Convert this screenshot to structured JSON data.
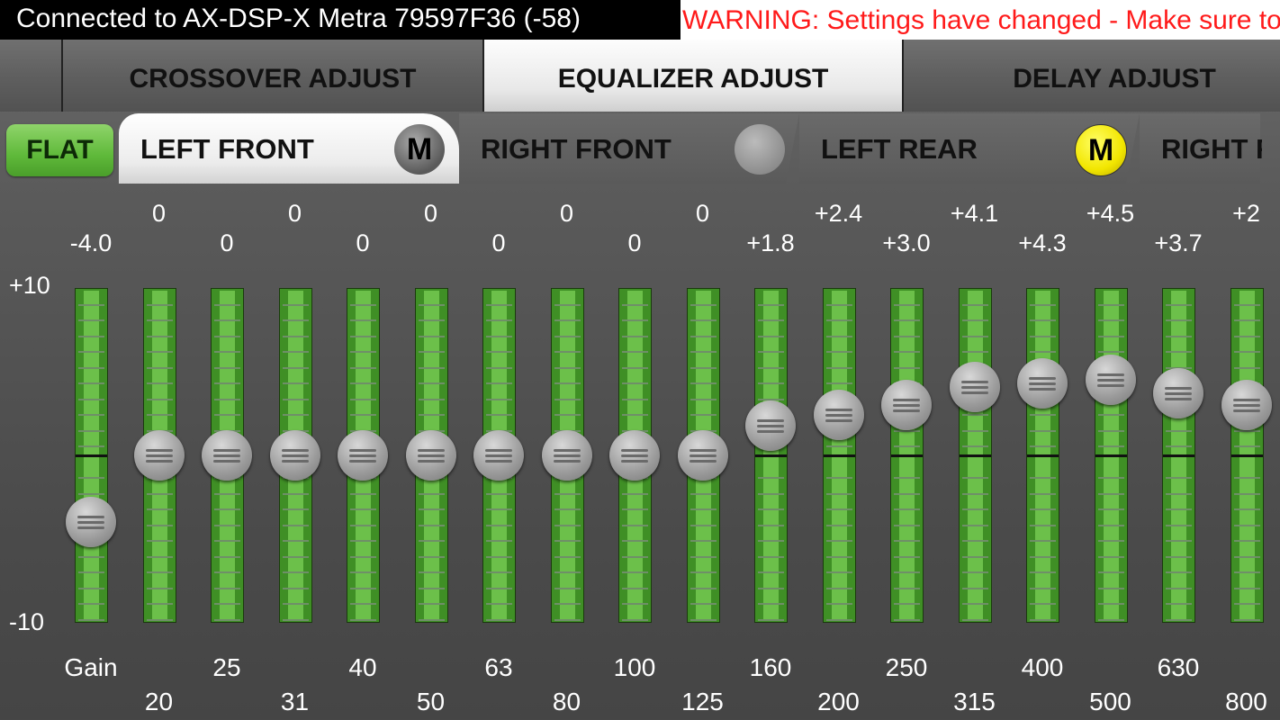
{
  "status": {
    "connection": "Connected to AX-DSP-X Metra 79597F36 (-58)",
    "warning": "WARNING: Settings have changed - Make sure to"
  },
  "mode_tabs": [
    {
      "label": "CROSSOVER ADJUST",
      "active": false
    },
    {
      "label": "EQUALIZER ADJUST",
      "active": true
    },
    {
      "label": "DELAY ADJUST",
      "active": false
    }
  ],
  "flat_button": "FLAT",
  "channels": [
    {
      "label": "LEFT FRONT",
      "active": true,
      "indicator": "M"
    },
    {
      "label": "RIGHT FRONT",
      "active": false,
      "indicator": ""
    },
    {
      "label": "LEFT REAR",
      "active": false,
      "indicator": "M"
    },
    {
      "label": "RIGHT R",
      "active": false,
      "indicator": ""
    }
  ],
  "axis": {
    "max": "+10",
    "min": "-10"
  },
  "bands": [
    {
      "freq": "Gain",
      "label": "-4.0",
      "value": -4.0
    },
    {
      "freq": "20",
      "label": "0",
      "value": 0
    },
    {
      "freq": "25",
      "label": "0",
      "value": 0
    },
    {
      "freq": "31",
      "label": "0",
      "value": 0
    },
    {
      "freq": "40",
      "label": "0",
      "value": 0
    },
    {
      "freq": "50",
      "label": "0",
      "value": 0
    },
    {
      "freq": "63",
      "label": "0",
      "value": 0
    },
    {
      "freq": "80",
      "label": "0",
      "value": 0
    },
    {
      "freq": "100",
      "label": "0",
      "value": 0
    },
    {
      "freq": "125",
      "label": "0",
      "value": 0
    },
    {
      "freq": "160",
      "label": "+1.8",
      "value": 1.8
    },
    {
      "freq": "200",
      "label": "+2.4",
      "value": 2.4
    },
    {
      "freq": "250",
      "label": "+3.0",
      "value": 3.0
    },
    {
      "freq": "315",
      "label": "+4.1",
      "value": 4.1
    },
    {
      "freq": "400",
      "label": "+4.3",
      "value": 4.3
    },
    {
      "freq": "500",
      "label": "+4.5",
      "value": 4.5
    },
    {
      "freq": "630",
      "label": "+3.7",
      "value": 3.7
    },
    {
      "freq": "800",
      "label": "+2",
      "value": 3.0
    }
  ],
  "colors": {
    "warning": "#ff1a1a",
    "track": "#3f8f25",
    "indicator_yellow": "#f2e600"
  }
}
